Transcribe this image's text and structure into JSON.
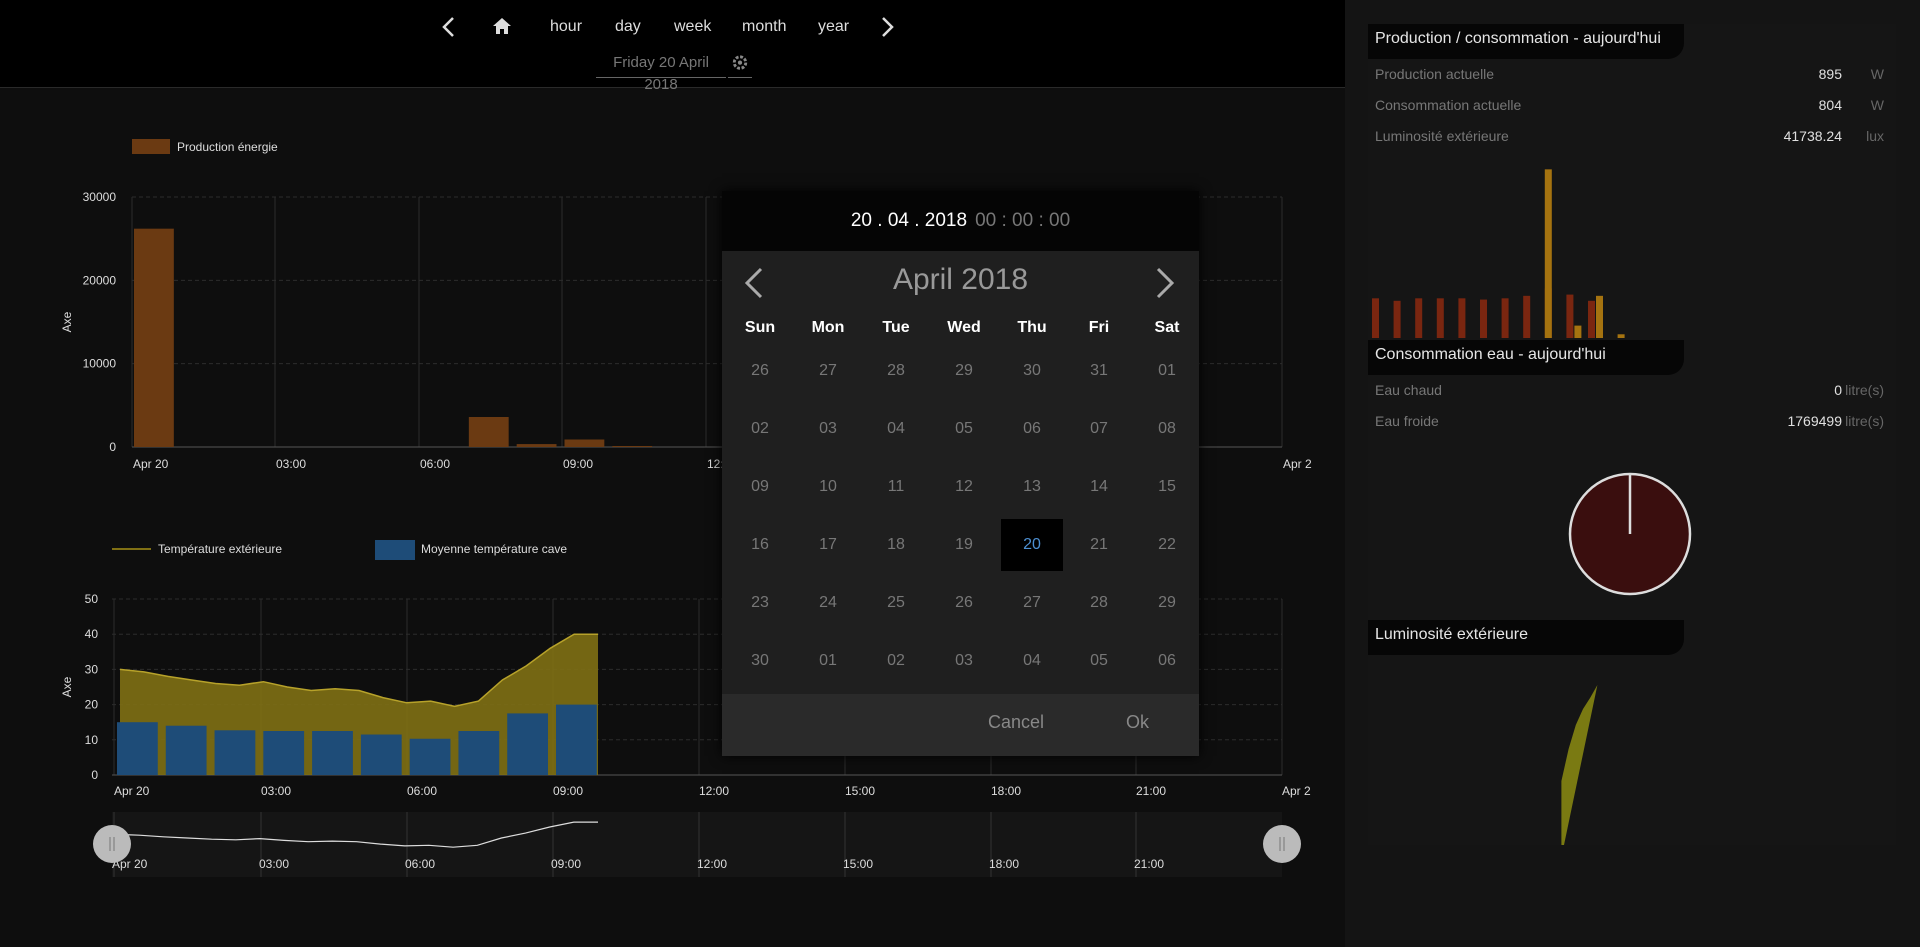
{
  "nav": {
    "items": [
      "hour",
      "day",
      "week",
      "month",
      "year"
    ],
    "date": "Friday 20 April 2018"
  },
  "chart_data": [
    {
      "type": "bar",
      "title": "",
      "ylabel": "Axe",
      "xlabel": "",
      "ylim": [
        0,
        30000
      ],
      "yticks": [
        "0",
        "10000",
        "20000",
        "30000"
      ],
      "x_ticks": [
        "Apr 20",
        "03:00",
        "06:00",
        "09:00",
        "12:00",
        "Apr 2"
      ],
      "legend": [
        "Production énergie"
      ],
      "series": [
        {
          "name": "Production énergie",
          "color": "#6b3a12",
          "x": [
            "00:00",
            "07:00",
            "08:00",
            "09:00",
            "10:00"
          ],
          "values": [
            26200,
            3600,
            350,
            900,
            120
          ]
        }
      ]
    },
    {
      "type": "area",
      "title": "",
      "ylabel": "Axe",
      "xlabel": "",
      "ylim": [
        0,
        50
      ],
      "yticks": [
        "0",
        "10",
        "20",
        "30",
        "40",
        "50"
      ],
      "x_ticks": [
        "Apr 20",
        "03:00",
        "06:00",
        "09:00",
        "12:00",
        "15:00",
        "18:00",
        "21:00",
        "Apr 2"
      ],
      "legend": [
        "Température extérieure",
        "Moyenne température cave"
      ],
      "series": [
        {
          "name": "Température extérieure",
          "type": "area",
          "color": "#807014",
          "x": [
            0,
            0.5,
            1,
            1.5,
            2,
            2.5,
            3,
            3.5,
            4,
            4.5,
            5,
            5.5,
            6,
            6.5,
            7,
            7.5,
            8,
            8.5,
            9,
            9.5,
            10
          ],
          "values": [
            30,
            29.3,
            28,
            27,
            26,
            25.5,
            26.5,
            25,
            24,
            24.5,
            24,
            22,
            20.5,
            21,
            19.5,
            21,
            27,
            31,
            36,
            40,
            40
          ]
        },
        {
          "name": "Moyenne température cave",
          "type": "bar",
          "color": "#1e4c78",
          "x": [
            "00:00",
            "01:00",
            "02:00",
            "03:00",
            "04:00",
            "05:00",
            "06:00",
            "07:00",
            "08:00",
            "09:00"
          ],
          "values": [
            15,
            14,
            12.7,
            12.5,
            12.5,
            11.5,
            10.3,
            12.5,
            17.5,
            20
          ]
        }
      ]
    },
    {
      "type": "line",
      "title": "",
      "x_ticks": [
        "Apr 20",
        "03:00",
        "06:00",
        "09:00",
        "12:00",
        "15:00",
        "18:00",
        "21:00"
      ],
      "series": [
        {
          "name": "Température extérieure",
          "values": [
            30,
            29.3,
            28,
            27,
            26,
            25.5,
            26.5,
            25,
            24,
            24.5,
            24,
            22,
            20.5,
            21,
            19.5,
            21,
            27,
            31,
            36,
            40,
            40
          ]
        }
      ]
    },
    {
      "type": "bar",
      "title": "",
      "series": [
        {
          "color": "#7a2610",
          "values": [
            3.2,
            3,
            3.2,
            3.2,
            3.2,
            3.1,
            3.2,
            3.4,
            4,
            3.5,
            3
          ]
        },
        {
          "color": "#a57310",
          "values": [
            0,
            0,
            0,
            0,
            0,
            0,
            0,
            0,
            13.6,
            1,
            3.4,
            0.3
          ]
        }
      ]
    },
    {
      "type": "pie",
      "title": "",
      "slices": [
        {
          "label": "Eau froide",
          "value": 1769499,
          "color": "#3a0e0e"
        },
        {
          "label": "Eau chaud",
          "value": 0
        }
      ]
    },
    {
      "type": "area",
      "title": "",
      "series": [
        {
          "color": "#7a7a12",
          "values": [
            0,
            0,
            0,
            0,
            0,
            0,
            0,
            0,
            0,
            0,
            0,
            0,
            0,
            0,
            0,
            0,
            0,
            0,
            0,
            0,
            0,
            0,
            0,
            0,
            0,
            0,
            0,
            0,
            0,
            0,
            0,
            0,
            40,
            60,
            75,
            85,
            92,
            100
          ]
        }
      ]
    }
  ],
  "datepicker": {
    "date": "20 . 04 . 2018",
    "time": "00 : 00 : 00",
    "month": "April 2018",
    "dows": [
      "Sun",
      "Mon",
      "Tue",
      "Wed",
      "Thu",
      "Fri",
      "Sat"
    ],
    "days": [
      [
        "26",
        "27",
        "28",
        "29",
        "30",
        "31",
        "01"
      ],
      [
        "02",
        "03",
        "04",
        "05",
        "06",
        "07",
        "08"
      ],
      [
        "09",
        "10",
        "11",
        "12",
        "13",
        "14",
        "15"
      ],
      [
        "16",
        "17",
        "18",
        "19",
        "20",
        "21",
        "22"
      ],
      [
        "23",
        "24",
        "25",
        "26",
        "27",
        "28",
        "29"
      ],
      [
        "30",
        "01",
        "02",
        "03",
        "04",
        "05",
        "06"
      ]
    ],
    "selected": "20",
    "cancel": "Cancel",
    "ok": "Ok"
  },
  "panels": {
    "prod": {
      "title": "Production / consommation - aujourd'hui",
      "rows": [
        {
          "label": "Production actuelle",
          "value": "895",
          "unit": "W"
        },
        {
          "label": "Consommation actuelle",
          "value": "804",
          "unit": "W"
        },
        {
          "label": "Luminosité extérieure",
          "value": "41738.24",
          "unit": "lux"
        }
      ]
    },
    "eau": {
      "title": "Consommation eau - aujourd'hui",
      "rows": [
        {
          "label": "Eau chaud",
          "value": "0",
          "unit": "litre(s)"
        },
        {
          "label": "Eau froide",
          "value": "1769499",
          "unit": "litre(s)"
        }
      ]
    },
    "lum": {
      "title": "Luminosité extérieure"
    }
  }
}
